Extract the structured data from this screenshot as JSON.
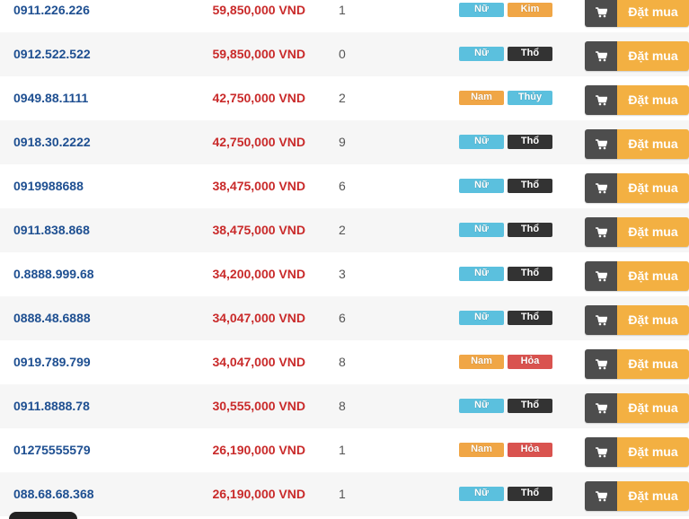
{
  "colors": {
    "tag_nam": "#f0a646",
    "tag_nu": "#5bc0de",
    "tag_kim": "#f0a646",
    "tag_tho": "#333333",
    "tag_thuy": "#5bc0de",
    "tag_hoa": "#d9534f"
  },
  "icons": {
    "cart": "cart-icon"
  },
  "rows": [
    {
      "number": "0911.226.226",
      "price": "59,850,000 VND",
      "score": "1",
      "gender": "Nữ",
      "gender_key": "nu",
      "element": "Kim",
      "element_key": "kim",
      "buy_label": "Đặt mua"
    },
    {
      "number": "0912.522.522",
      "price": "59,850,000 VND",
      "score": "0",
      "gender": "Nữ",
      "gender_key": "nu",
      "element": "Thổ",
      "element_key": "tho",
      "buy_label": "Đặt mua"
    },
    {
      "number": "0949.88.1111",
      "price": "42,750,000 VND",
      "score": "2",
      "gender": "Nam",
      "gender_key": "nam",
      "element": "Thủy",
      "element_key": "thuy",
      "buy_label": "Đặt mua"
    },
    {
      "number": "0918.30.2222",
      "price": "42,750,000 VND",
      "score": "9",
      "gender": "Nữ",
      "gender_key": "nu",
      "element": "Thổ",
      "element_key": "tho",
      "buy_label": "Đặt mua"
    },
    {
      "number": "0919988688",
      "price": "38,475,000 VND",
      "score": "6",
      "gender": "Nữ",
      "gender_key": "nu",
      "element": "Thổ",
      "element_key": "tho",
      "buy_label": "Đặt mua"
    },
    {
      "number": "0911.838.868",
      "price": "38,475,000 VND",
      "score": "2",
      "gender": "Nữ",
      "gender_key": "nu",
      "element": "Thổ",
      "element_key": "tho",
      "buy_label": "Đặt mua"
    },
    {
      "number": "0.8888.999.68",
      "price": "34,200,000 VND",
      "score": "3",
      "gender": "Nữ",
      "gender_key": "nu",
      "element": "Thổ",
      "element_key": "tho",
      "buy_label": "Đặt mua"
    },
    {
      "number": "0888.48.6888",
      "price": "34,047,000 VND",
      "score": "6",
      "gender": "Nữ",
      "gender_key": "nu",
      "element": "Thổ",
      "element_key": "tho",
      "buy_label": "Đặt mua"
    },
    {
      "number": "0919.789.799",
      "price": "34,047,000 VND",
      "score": "8",
      "gender": "Nam",
      "gender_key": "nam",
      "element": "Hỏa",
      "element_key": "hoa",
      "buy_label": "Đặt mua"
    },
    {
      "number": "0911.8888.78",
      "price": "30,555,000 VND",
      "score": "8",
      "gender": "Nữ",
      "gender_key": "nu",
      "element": "Thổ",
      "element_key": "tho",
      "buy_label": "Đặt mua"
    },
    {
      "number": "01275555579",
      "price": "26,190,000 VND",
      "score": "1",
      "gender": "Nam",
      "gender_key": "nam",
      "element": "Hỏa",
      "element_key": "hoa",
      "buy_label": "Đặt mua"
    },
    {
      "number": "088.68.68.368",
      "price": "26,190,000 VND",
      "score": "1",
      "gender": "Nữ",
      "gender_key": "nu",
      "element": "Thổ",
      "element_key": "tho",
      "buy_label": "Đặt mua"
    }
  ]
}
